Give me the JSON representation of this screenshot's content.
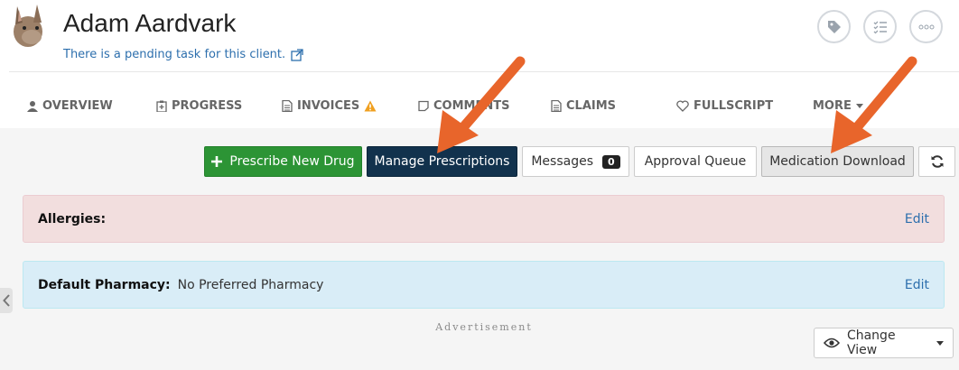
{
  "client": {
    "name": "Adam Aardvark",
    "pending_task": "There is a pending task for this client."
  },
  "tabs": [
    {
      "label": "OVERVIEW",
      "icon": "user-icon"
    },
    {
      "label": "PROGRESS",
      "icon": "clipboard-icon"
    },
    {
      "label": "INVOICES",
      "icon": "document-icon",
      "warning": true
    },
    {
      "label": "COMMENTS",
      "icon": "note-icon"
    },
    {
      "label": "CLAIMS",
      "icon": "document-icon"
    },
    {
      "label": "FULLSCRIPT",
      "icon": "heart-icon"
    },
    {
      "label": "MORE",
      "icon": "caret-down-icon"
    }
  ],
  "toolbar": {
    "prescribe_label": "Prescribe New Drug",
    "manage_label": "Manage Prescriptions",
    "messages_label": "Messages",
    "messages_count": "0",
    "approval_label": "Approval Queue",
    "med_download_label": "Medication Download"
  },
  "allergies": {
    "label": "Allergies:",
    "edit": "Edit"
  },
  "pharmacy": {
    "label": "Default Pharmacy:",
    "value": "No Preferred Pharmacy",
    "edit": "Edit"
  },
  "advertisement": "Advertisement",
  "change_view": "Change View",
  "colors": {
    "primary_green": "#2c9435",
    "dark_navy": "#12324d",
    "link_blue": "#2d6fad",
    "arrow_orange": "#e8652b",
    "warning_orange": "#f0a020"
  }
}
